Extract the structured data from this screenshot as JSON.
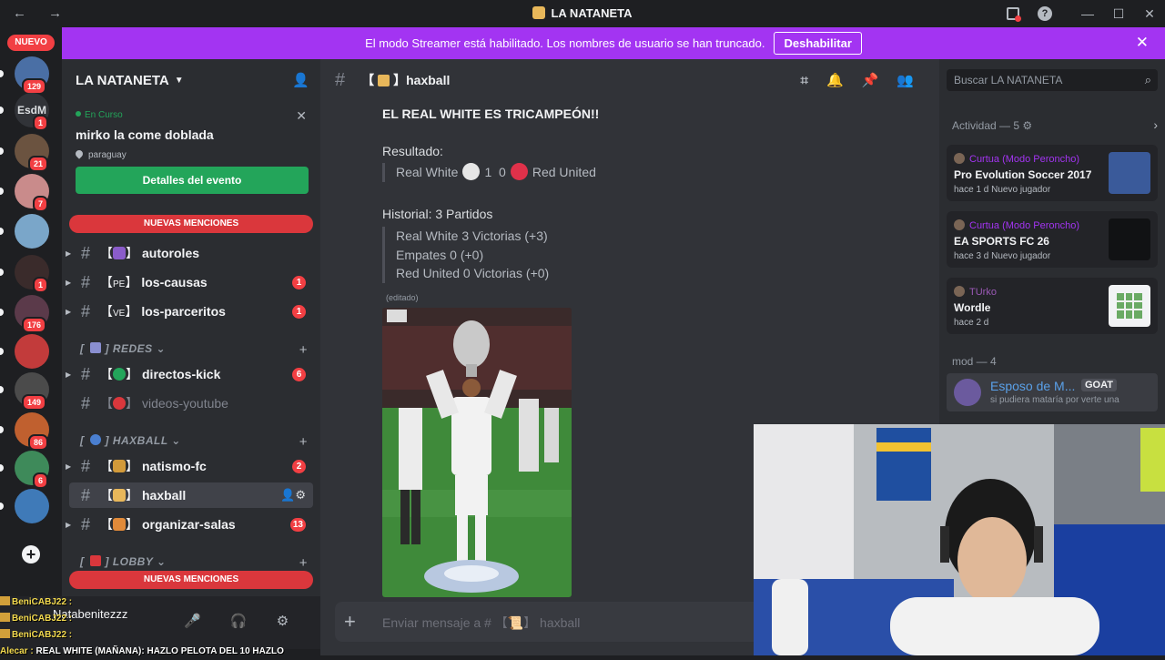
{
  "window": {
    "title": "LA NATANETA",
    "nav": "← →",
    "controls": [
      "—",
      "☐",
      "✕"
    ]
  },
  "banner": {
    "text": "El modo Streamer está habilitado. Los nombres de usuario se han truncado.",
    "button": "Deshabilitar"
  },
  "servers": {
    "nuevo": "NUEVO",
    "items": [
      {
        "label": "",
        "badge": "129",
        "color": "#4a6fa5"
      },
      {
        "label": "EsdM",
        "badge": "1",
        "color": "#313338"
      },
      {
        "label": "",
        "badge": "21",
        "color": "#6b5340"
      },
      {
        "label": "",
        "badge": "7",
        "color": "#c98b8b"
      },
      {
        "label": "",
        "badge": "",
        "color": "#7aa6c9"
      },
      {
        "label": "",
        "badge": "1",
        "color": "#3a2b2b"
      },
      {
        "label": "",
        "badge": "176",
        "color": "#5b3a4a"
      },
      {
        "label": "",
        "badge": "",
        "color": "#c23b3b"
      },
      {
        "label": "",
        "badge": "149",
        "color": "#4b4b4b"
      },
      {
        "label": "",
        "badge": "86",
        "color": "#c0602f"
      },
      {
        "label": "",
        "badge": "6",
        "color": "#3e8a5a"
      },
      {
        "label": "",
        "badge": "",
        "color": "#3f7ab8"
      }
    ]
  },
  "guild": {
    "name": "LA NATANETA",
    "event": {
      "status": "En Curso",
      "title": "mirko la come doblada",
      "location": "paraguay",
      "button": "Detalles del evento"
    },
    "mentions_label": "NUEVAS MENCIONES",
    "channels_top": [
      {
        "emoji_color": "#8a5cc9",
        "name": "autoroles",
        "badge": ""
      },
      {
        "emoji_text": "PE",
        "name": "los-causas",
        "badge": "1"
      },
      {
        "emoji_text": "VE",
        "name": "los-parceritos",
        "badge": "1"
      }
    ],
    "category_redes": "REDES",
    "channels_redes": [
      {
        "emoji_color": "#23a55a",
        "name": "directos-kick",
        "badge": "6",
        "muted": false
      },
      {
        "emoji_color": "#da373c",
        "name": "videos-youtube",
        "badge": "",
        "muted": true
      }
    ],
    "category_haxball": "HAXBALL",
    "channels_haxball": [
      {
        "emoji_color": "#d29a3a",
        "name": "natismo-fc",
        "badge": "2"
      },
      {
        "emoji_color": "#e8b75a",
        "name": "haxball",
        "badge": ""
      },
      {
        "emoji_color": "#e08a3a",
        "name": "organizar-salas",
        "badge": "13"
      }
    ],
    "category_lobby": "LOBBY"
  },
  "user": {
    "name": "Natabenitezzz"
  },
  "stream_chat": [
    {
      "who": "BeniCABJ22 :",
      "text": ""
    },
    {
      "who": "BeniCABJ22 :",
      "text": ""
    },
    {
      "who": "BeniCABJ22 :",
      "text": ""
    },
    {
      "who": "Alecar :",
      "text": "REAL WHITE (MAÑANA): HAZLO PELOTA DEL 10 HAZLO"
    }
  ],
  "channel": {
    "name": "haxball",
    "composer_placeholder": "Enviar mensaje a # 【📜】 haxball"
  },
  "message": {
    "headline": "EL REAL WHITE ES TRICAMPEÓN!!",
    "result_label": "Resultado:",
    "team_a": "Real White",
    "score_a": "1",
    "score_b": "0",
    "team_b": "Red United",
    "history_label": "Historial:  3 Partidos",
    "history": [
      "Real White 3 Victorias (+3)",
      "Empates 0 (+0)",
      "Red United 0 Victorias (+0)"
    ],
    "edited": "(editado)"
  },
  "sidebar": {
    "search_placeholder": "Buscar LA NATANETA",
    "activity_title": "Actividad — 5",
    "activities": [
      {
        "user": "Curtua (Modo Peroncho)",
        "game": "Pro Evolution Soccer 2017",
        "meta": "hace 1 d   Nuevo jugador",
        "thumb": "#3a5a9a"
      },
      {
        "user": "Curtua (Modo Peroncho)",
        "game": "EA SPORTS FC 26",
        "meta": "hace 3 d   Nuevo jugador",
        "thumb": "#111214"
      },
      {
        "user": "TUrko",
        "game": "Wordle",
        "meta": "hace 2 d",
        "thumb": "#f2f3f5"
      }
    ],
    "mod_title": "mod — 4",
    "member": {
      "name": "Esposo de M...",
      "tag": "GOAT",
      "status": "si pudiera mataría por verte una"
    }
  }
}
